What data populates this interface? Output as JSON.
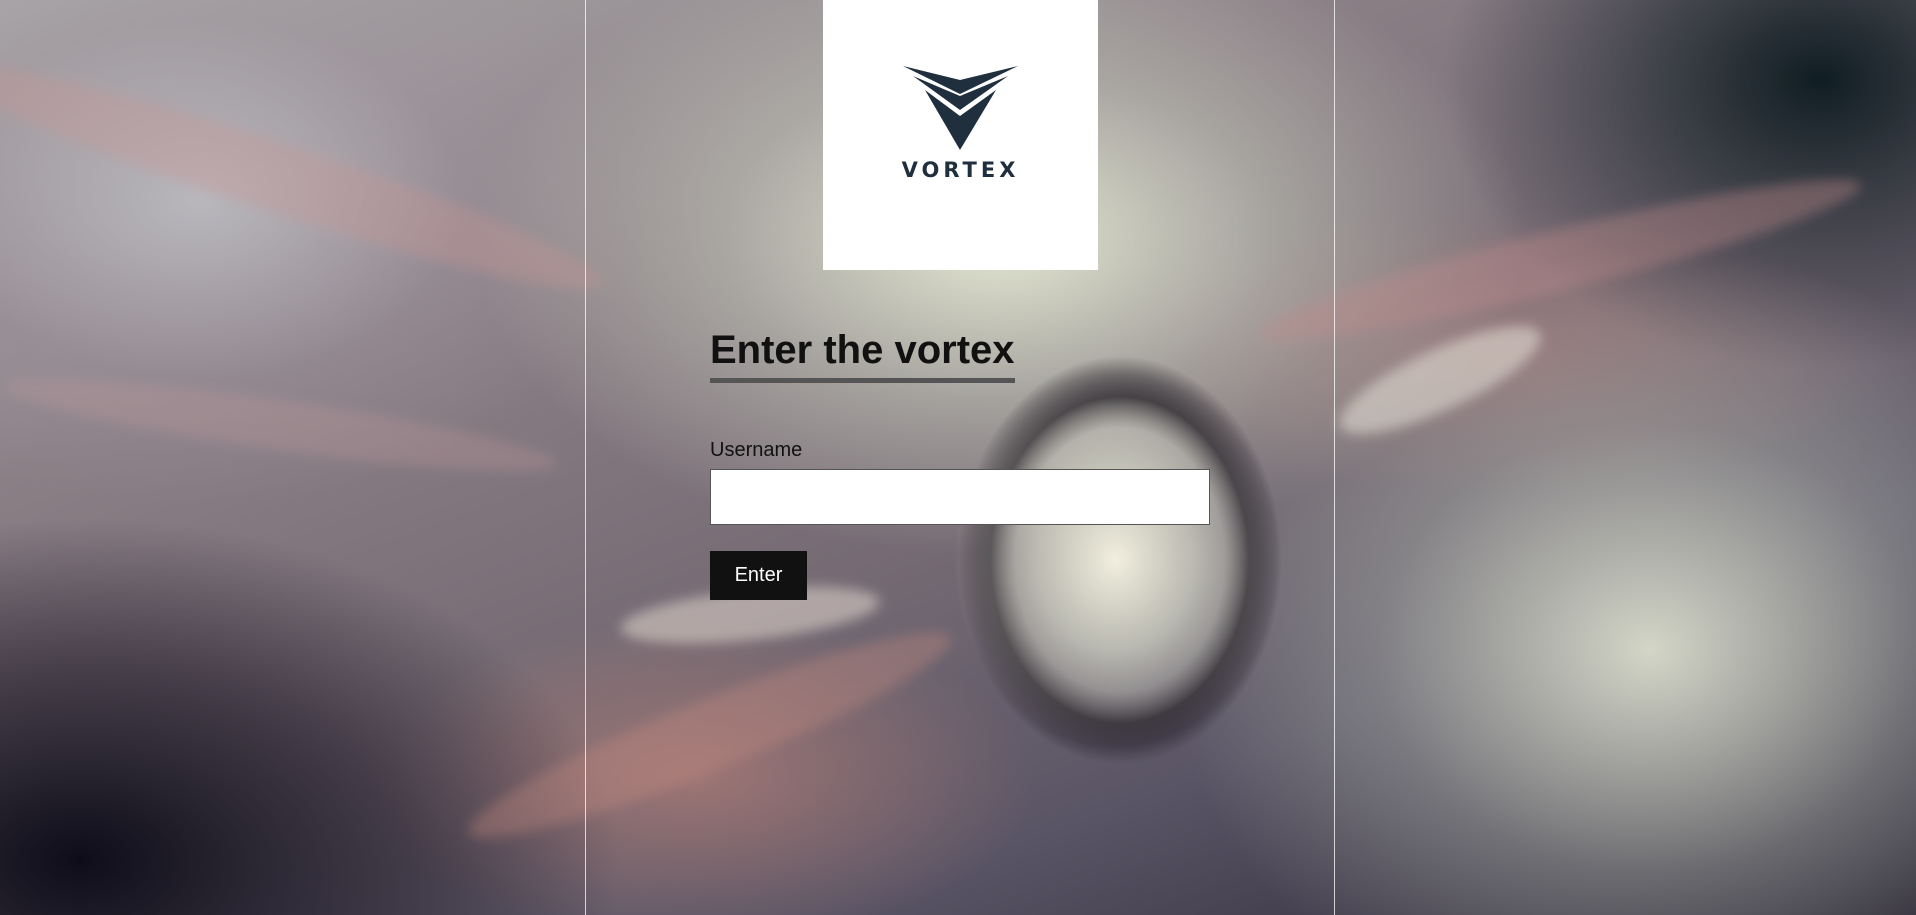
{
  "brand": {
    "name": "VORTEX",
    "logo_color": "#1f2f3d"
  },
  "login": {
    "heading": "Enter the vortex",
    "username_label": "Username",
    "username_value": "",
    "username_placeholder": "",
    "submit_label": "Enter"
  },
  "colors": {
    "button_bg": "#111111",
    "button_text": "#ffffff",
    "heading_underline": "#555555"
  }
}
